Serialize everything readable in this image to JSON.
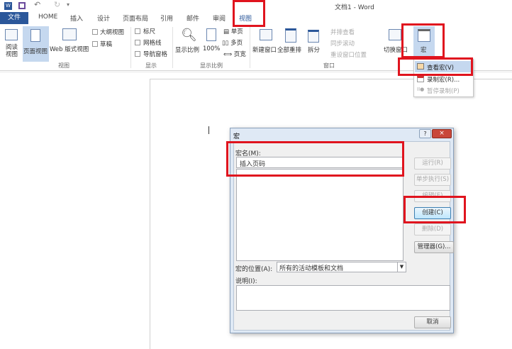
{
  "window": {
    "title": "文档1 - Word"
  },
  "tabs": [
    "文件",
    "HOME",
    "插入",
    "设计",
    "页面布局",
    "引用",
    "邮件",
    "审阅",
    "视图"
  ],
  "ribbon": {
    "views_group": {
      "label": "视图",
      "buttons": [
        "阅读\n视图",
        "页面视图",
        "Web 版式视图"
      ],
      "small": [
        "大纲视图",
        "草稿"
      ]
    },
    "show_group": {
      "label": "显示",
      "checks": [
        "标尺",
        "网格线",
        "导航窗格"
      ]
    },
    "zoom_group": {
      "label": "显示比例",
      "buttons": [
        "显示比例",
        "100%"
      ],
      "small": [
        "单页",
        "多页",
        "页宽"
      ]
    },
    "window_group": {
      "label": "窗口",
      "buttons": [
        "新建窗口",
        "全部重排",
        "拆分"
      ],
      "small": [
        "并排查看",
        "同步滚动",
        "重设窗口位置"
      ],
      "switch": "切换窗口"
    },
    "macro_button": "宏"
  },
  "macro_menu": {
    "items": [
      "查看宏(V)",
      "录制宏(R)...",
      "暂停录制(P)"
    ]
  },
  "dialog": {
    "title": "宏",
    "help": "?",
    "close": "×",
    "name_label": "宏名(M):",
    "name_value": "插入页码",
    "buttons": {
      "run": "运行(R)",
      "step": "单步执行(S)",
      "edit": "编辑(E)",
      "create": "创建(C)",
      "delete": "删除(D)",
      "organizer": "管理器(G)...",
      "cancel": "取消"
    },
    "location_label": "宏的位置(A):",
    "location_value": "所有的活动模板和文档",
    "description_label": "说明(I):"
  },
  "colors": {
    "accent": "#2b579a",
    "highlight": "#e0141e"
  }
}
